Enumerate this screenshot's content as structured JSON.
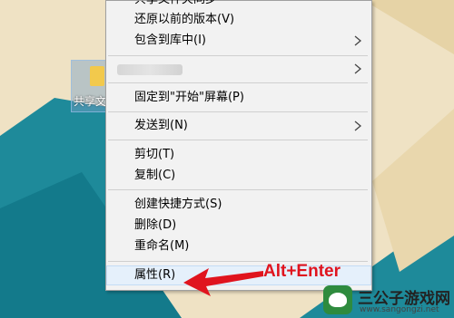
{
  "desktop": {
    "icon_label": "共享文",
    "background_colors": {
      "sand": "#efe2c4",
      "teal": "#1e8a9a",
      "dark_teal": "#0f6d7e"
    }
  },
  "context_menu": {
    "top_partial_label": "共享文件夹同步",
    "items": [
      {
        "label": "还原以前的版本(V)",
        "has_submenu": false
      },
      {
        "label": "包含到库中(I)",
        "has_submenu": true
      },
      {
        "label": "",
        "has_submenu": true,
        "blurred": true
      },
      {
        "label": "固定到\"开始\"屏幕(P)",
        "has_submenu": false
      },
      {
        "label": "发送到(N)",
        "has_submenu": true
      },
      {
        "label": "剪切(T)",
        "has_submenu": false
      },
      {
        "label": "复制(C)",
        "has_submenu": false
      },
      {
        "label": "创建快捷方式(S)",
        "has_submenu": false
      },
      {
        "label": "删除(D)",
        "has_submenu": false
      },
      {
        "label": "重命名(M)",
        "has_submenu": false
      },
      {
        "label": "属性(R)",
        "has_submenu": false,
        "highlighted": true
      }
    ],
    "highlight_color": "#e5f0fb"
  },
  "annotation": {
    "text": "Alt+Enter",
    "color": "#e0141e"
  },
  "watermark": {
    "title": "三公子游戏网",
    "url": "www.sangongzi.net"
  }
}
